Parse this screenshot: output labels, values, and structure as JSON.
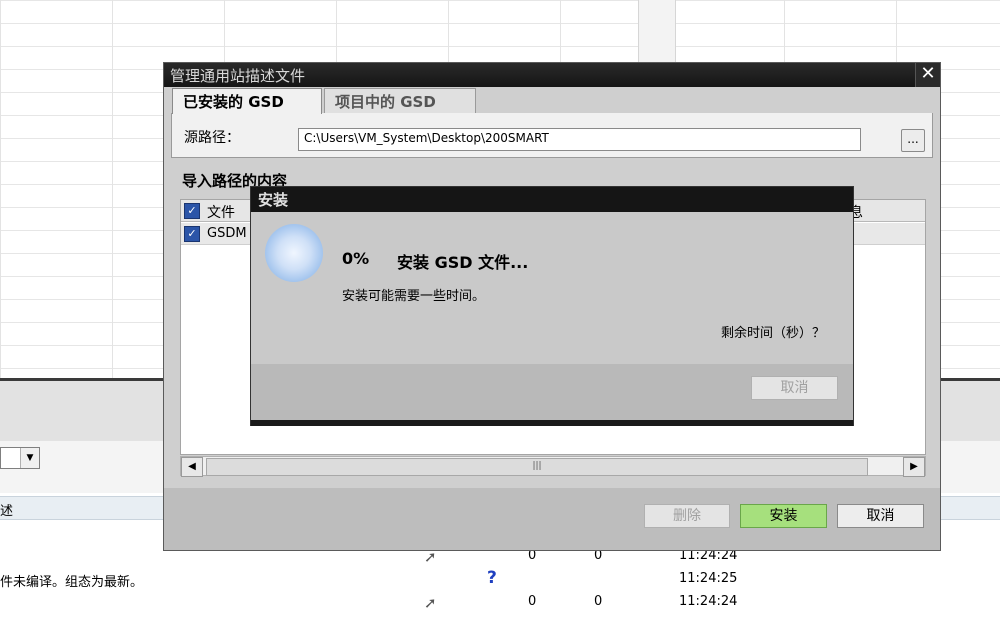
{
  "background": {
    "desc_header": "述",
    "rows": [
      {
        "text": "",
        "icon": "arrow-icon",
        "n1": "0",
        "n2": "0",
        "time": "11:24:24"
      },
      {
        "text": "件未编译。组态为最新。",
        "icon": "question-icon",
        "n1": "",
        "n2": "",
        "time": "11:24:25"
      },
      {
        "text": "",
        "icon": "arrow-icon",
        "n1": "0",
        "n2": "0",
        "time": "11:24:24"
      }
    ]
  },
  "dialog": {
    "title": "管理通用站描述文件",
    "tabs": [
      {
        "label": "已安装的 GSD",
        "active": true
      },
      {
        "label": "项目中的 GSD",
        "active": false
      }
    ],
    "source_label": "源路径：",
    "source_path": "C:\\Users\\VM_System\\Desktop\\200SMART",
    "browse_label": "...",
    "section_title": "导入路径的内容",
    "table": {
      "col_file": "文件",
      "col_info": "息",
      "rows": [
        {
          "file": "GSDM",
          "checked": true
        }
      ]
    },
    "buttons": {
      "delete": "删除",
      "install": "安装",
      "cancel": "取消"
    }
  },
  "progress": {
    "title": "安装",
    "percent": "0%",
    "message": "安装 GSD 文件...",
    "subtext": "安装可能需要一些时间。",
    "remaining": "剩余时间（秒）？",
    "cancel": "取消"
  }
}
